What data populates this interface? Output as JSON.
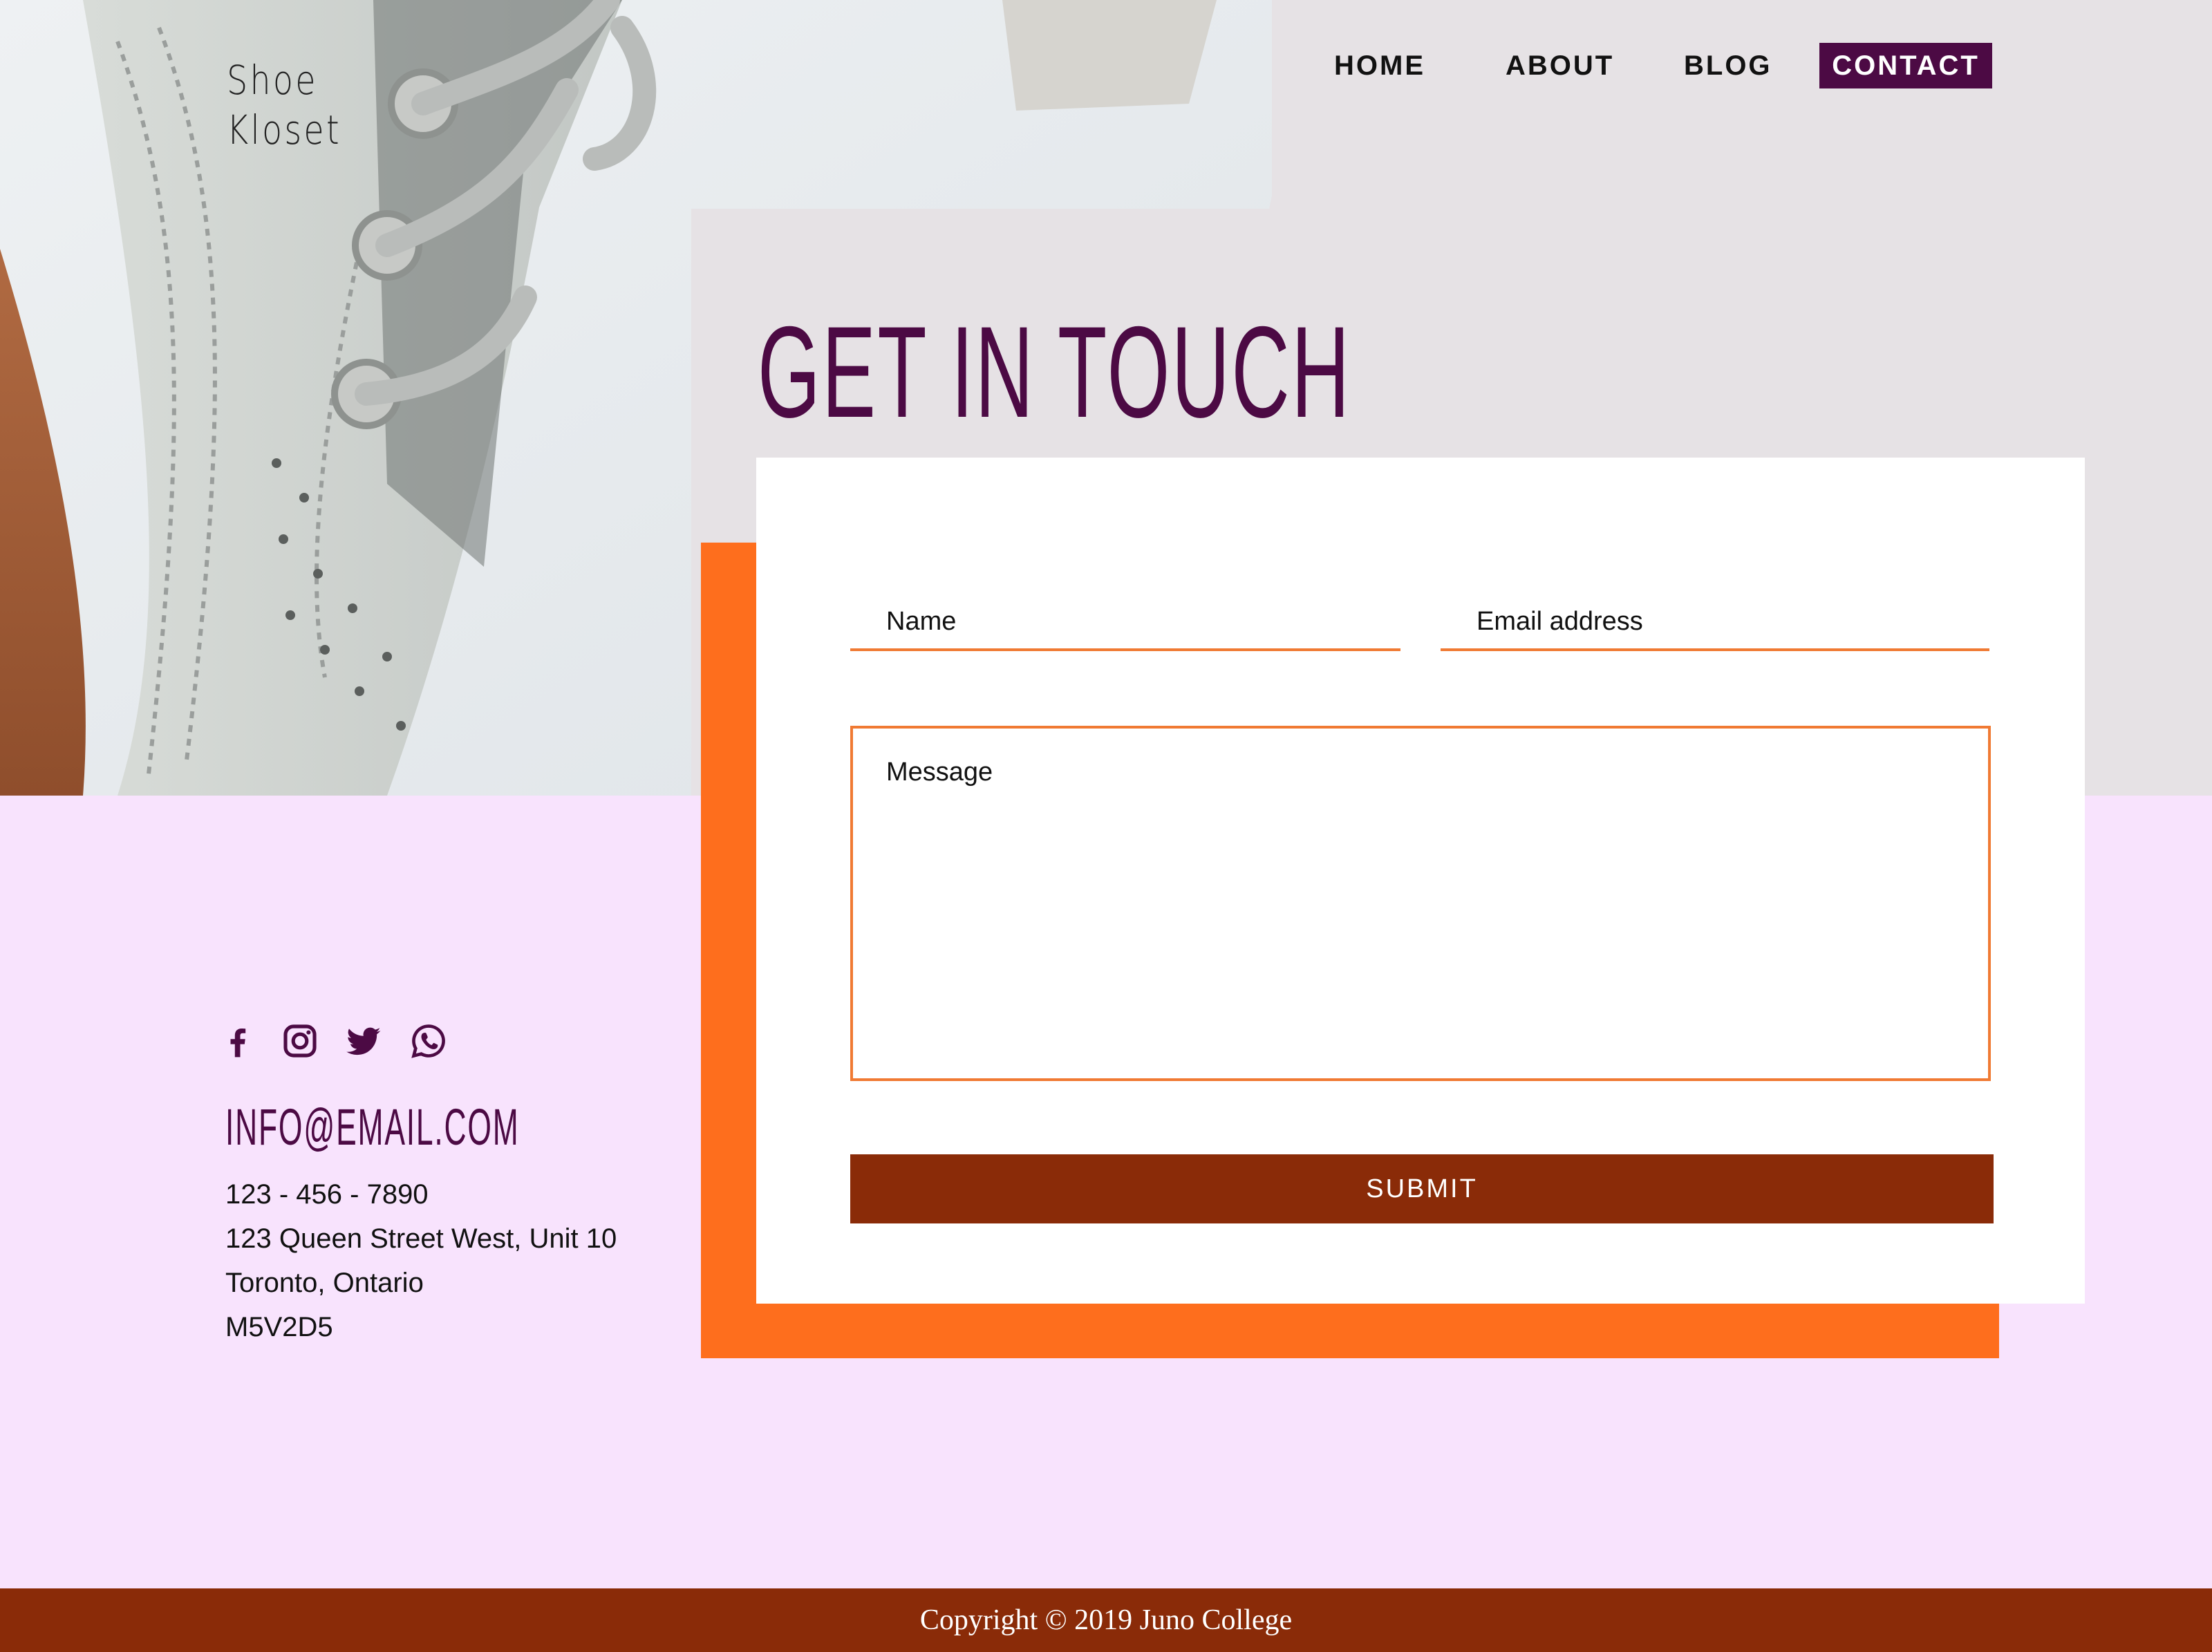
{
  "brand": {
    "logo_line1": "Shoe",
    "logo_line2": "Kloset"
  },
  "nav": {
    "items": [
      {
        "label": "HOME"
      },
      {
        "label": "ABOUT"
      },
      {
        "label": "BLOG"
      },
      {
        "label": "CONTACT",
        "active": true
      }
    ]
  },
  "page": {
    "title": "GET IN TOUCH"
  },
  "form": {
    "name_placeholder": "Name",
    "email_placeholder": "Email address",
    "message_placeholder": "Message",
    "submit_label": "SUBMIT"
  },
  "contact": {
    "social_icons": [
      "facebook-icon",
      "instagram-icon",
      "twitter-icon",
      "whatsapp-icon"
    ],
    "email": "INFO@EMAIL.COM",
    "phone": "123 - 456 - 7890",
    "address_line1": "123 Queen Street West, Unit 10",
    "address_line2": "Toronto, Ontario",
    "postal": "M5V2D5"
  },
  "footer": {
    "copyright": "Copyright © 2019 Juno College"
  },
  "colors": {
    "brand_purple": "#4c0a44",
    "accent_orange": "#fe6e1d",
    "rust": "#8a2b08",
    "lilac_bg": "#f8e3fd",
    "hero_gray": "#e6e2e5"
  }
}
